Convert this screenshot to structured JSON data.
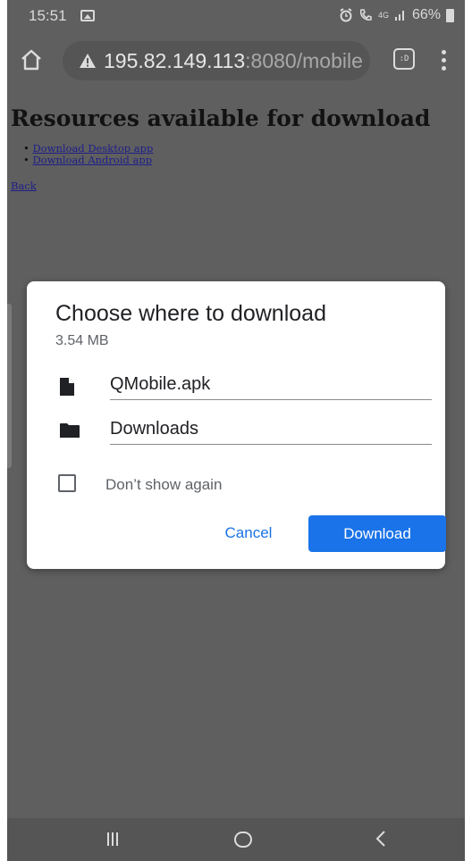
{
  "status_bar": {
    "time": "15:51",
    "network_label": "4G",
    "battery": "66%",
    "icons": [
      "gallery-icon",
      "alarm-icon",
      "call-icon",
      "data-arrows-icon",
      "signal-icon",
      "battery-icon"
    ]
  },
  "browser": {
    "url_host": "195.82.149.113",
    "url_path": ":8080/mobile",
    "tab_icon_text": ":D",
    "icons": [
      "home-icon",
      "warning-icon",
      "tab-switch-icon",
      "menu-icon"
    ]
  },
  "page": {
    "title": "Resources available for download",
    "links": [
      "Download Desktop app",
      "Download Android app"
    ],
    "back_label": "Back"
  },
  "dialog": {
    "title": "Choose where to download",
    "size": "3.54 MB",
    "filename": "QMobile.apk",
    "location": "Downloads",
    "checkbox_label": "Don’t show again",
    "checkbox_checked": false,
    "cancel_label": "Cancel",
    "download_label": "Download",
    "accent_color": "#1a73e8"
  },
  "nav": {
    "icons": [
      "recent-apps-icon",
      "home-button-icon",
      "back-icon"
    ]
  }
}
